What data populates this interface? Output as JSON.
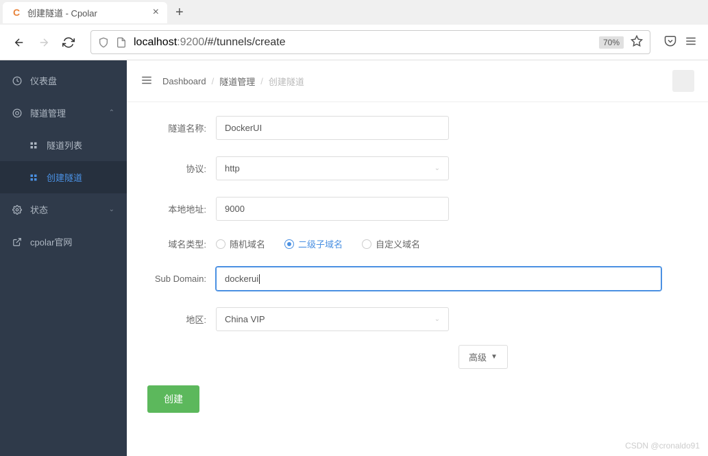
{
  "browser": {
    "tab_title": "创建隧道 - Cpolar",
    "favicon_letter": "C",
    "url_host": "localhost",
    "url_port": ":9200",
    "url_path": "/#/tunnels/create",
    "zoom": "70%"
  },
  "sidebar": {
    "items": [
      {
        "label": "仪表盘",
        "icon": "dashboard"
      },
      {
        "label": "隧道管理",
        "icon": "target",
        "expanded": true
      },
      {
        "label": "隧道列表",
        "icon": "grid",
        "child": true
      },
      {
        "label": "创建隧道",
        "icon": "grid",
        "child": true,
        "active": true
      },
      {
        "label": "状态",
        "icon": "gear",
        "expandable": true
      },
      {
        "label": "cpolar官网",
        "icon": "link"
      }
    ]
  },
  "breadcrumb": {
    "items": [
      "Dashboard",
      "隧道管理",
      "创建隧道"
    ]
  },
  "form": {
    "tunnel_name_label": "隧道名称:",
    "tunnel_name_value": "DockerUI",
    "protocol_label": "协议:",
    "protocol_value": "http",
    "local_addr_label": "本地地址:",
    "local_addr_value": "9000",
    "domain_type_label": "域名类型:",
    "domain_type_options": [
      "随机域名",
      "二级子域名",
      "自定义域名"
    ],
    "domain_type_selected": 1,
    "subdomain_label": "Sub Domain:",
    "subdomain_value": "dockerui",
    "region_label": "地区:",
    "region_value": "China VIP",
    "advanced_label": "高级",
    "submit_label": "创建"
  },
  "watermark": "CSDN @cronaldo91"
}
